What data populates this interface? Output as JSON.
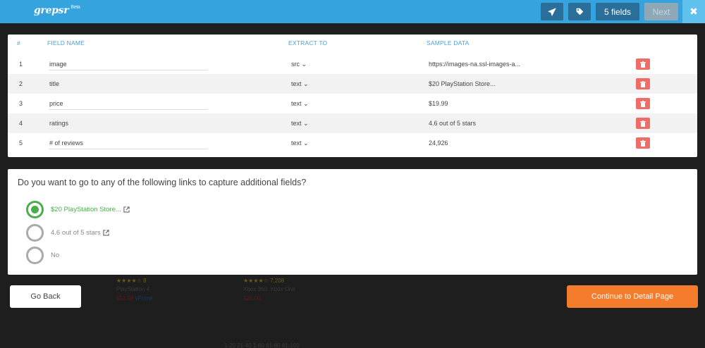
{
  "topbar": {
    "logo": "grepsr",
    "logo_badge": "Beta",
    "send_icon": "paper-plane-icon",
    "tag_icon": "tag-icon",
    "fields_label": "5 fields",
    "next_label": "Next",
    "close_label": "✖"
  },
  "table": {
    "headers": {
      "num": "#",
      "field_name": "FIELD NAME",
      "extract_to": "EXTRACT TO",
      "sample_data": "SAMPLE DATA"
    },
    "rows": [
      {
        "num": "1",
        "field": "image",
        "extract": "src",
        "sample": "https://images-na.ssl-images-a..."
      },
      {
        "num": "2",
        "field": "title",
        "extract": "text",
        "sample": "$20 PlayStation Store..."
      },
      {
        "num": "3",
        "field": "price",
        "extract": "text",
        "sample": "$19.99"
      },
      {
        "num": "4",
        "field": "ratings",
        "extract": "text",
        "sample": "4.6 out of 5 stars"
      },
      {
        "num": "5",
        "field": "# of reviews",
        "extract": "text",
        "sample": "24,926"
      }
    ],
    "delete_icon": "trash-icon",
    "colors": {
      "header": "#4aa0d9",
      "delete": "#ef6d66"
    }
  },
  "links": {
    "question": "Do you want to go to any of the following links to capture additional fields?",
    "options": [
      {
        "label": "$20 PlayStation Store...",
        "selected": true,
        "external": true
      },
      {
        "label": "4.6 out of 5 stars",
        "selected": false,
        "external": true
      },
      {
        "label": "No",
        "selected": false,
        "external": false
      }
    ],
    "colors": {
      "selected": "#4aaf4a"
    }
  },
  "footer": {
    "back_label": "Go Back",
    "continue_label": "Continue to Detail Page",
    "colors": {
      "continue": "#f47c2c"
    }
  },
  "background_page": {
    "items": [
      {
        "rating": "8",
        "name": "PlayStation 4",
        "price": "$51.99",
        "prime": "vPrime"
      },
      {
        "rating": "7,208",
        "name": "Xbox 360, Xbox One",
        "price": "$20.00"
      }
    ],
    "pagination": "1-20  21-40  1-60  61-80  81-100"
  }
}
